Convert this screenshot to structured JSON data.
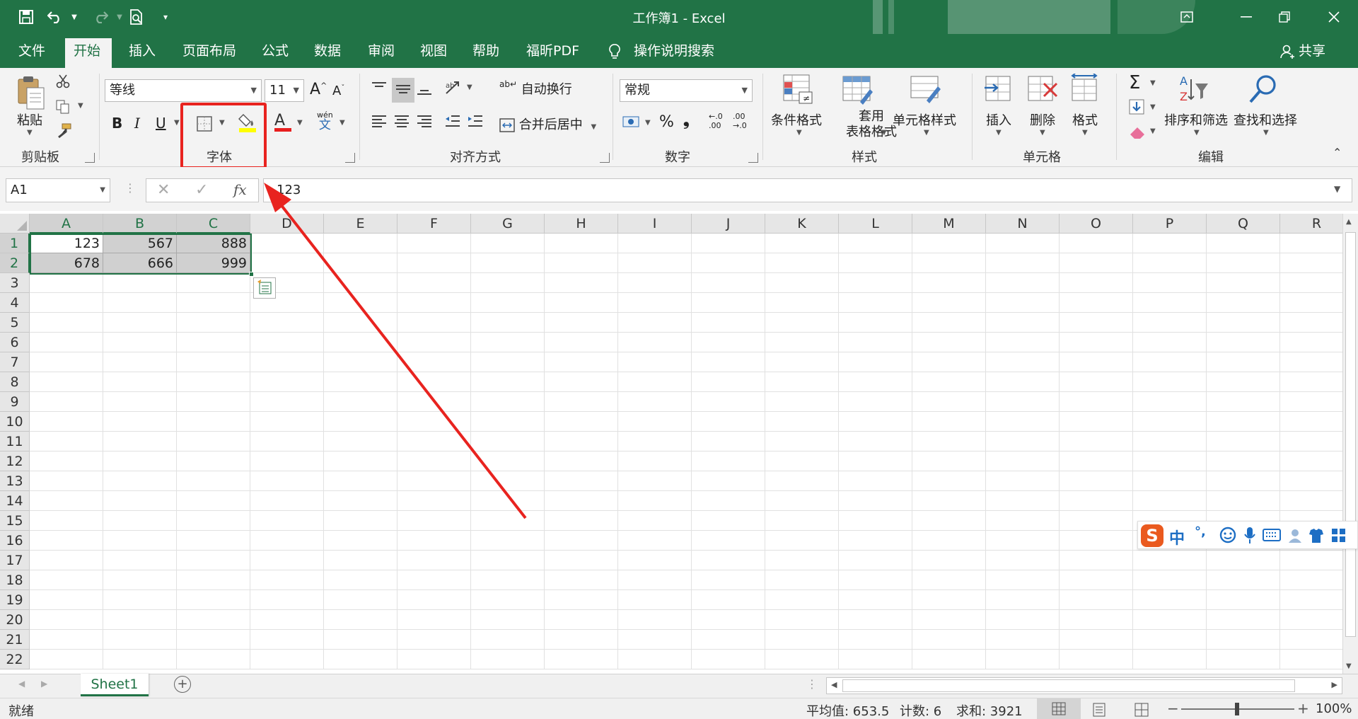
{
  "window": {
    "title": "工作簿1  -  Excel",
    "share_label": "共享"
  },
  "tabs": [
    {
      "label": "文件"
    },
    {
      "label": "开始"
    },
    {
      "label": "插入"
    },
    {
      "label": "页面布局"
    },
    {
      "label": "公式"
    },
    {
      "label": "数据"
    },
    {
      "label": "审阅"
    },
    {
      "label": "视图"
    },
    {
      "label": "帮助"
    },
    {
      "label": "福昕PDF"
    },
    {
      "label": "操作说明搜索"
    }
  ],
  "ribbon": {
    "clipboard": {
      "paste_label": "粘贴",
      "group_label": "剪贴板"
    },
    "font": {
      "font_name": "等线",
      "font_size": "11",
      "bold": "B",
      "italic": "I",
      "underline": "U",
      "font_color_glyph": "A",
      "phonetic_top": "wén",
      "phonetic_bottom": "文",
      "group_label": "字体"
    },
    "alignment": {
      "wrap_label": "自动换行",
      "merge_label": "合并后居中",
      "group_label": "对齐方式"
    },
    "number": {
      "format": "常规",
      "percent": "%",
      "comma": "❟",
      "inc_dec": ".00",
      "inc_dec_top": "←.0",
      "dec_dec_top": ".00",
      "dec_dec": "→.0",
      "group_label": "数字"
    },
    "styles": {
      "conditional_label": "条件格式",
      "table_label_1": "套用",
      "table_label_2": "表格格式",
      "cell_style_label": "单元格样式",
      "group_label": "样式"
    },
    "cells": {
      "insert_label": "插入",
      "delete_label": "删除",
      "format_label": "格式",
      "group_label": "单元格"
    },
    "editing": {
      "sort_label": "排序和筛选",
      "find_label": "查找和选择",
      "group_label": "编辑"
    }
  },
  "formula_bar": {
    "name_box": "A1",
    "fx": "fx",
    "content": "123"
  },
  "grid": {
    "columns": [
      "A",
      "B",
      "C",
      "D",
      "E",
      "F",
      "G",
      "H",
      "I",
      "J",
      "K",
      "L",
      "M",
      "N",
      "O",
      "P",
      "Q",
      "R"
    ],
    "rows": [
      "1",
      "2",
      "3",
      "4",
      "5",
      "6",
      "7",
      "8",
      "9",
      "10",
      "11",
      "12",
      "13",
      "14",
      "15",
      "16",
      "17",
      "18",
      "19",
      "20",
      "21",
      "22"
    ],
    "cells": [
      [
        "123",
        "567",
        "888"
      ],
      [
        "678",
        "666",
        "999"
      ]
    ]
  },
  "sheets": {
    "tabs": [
      "Sheet1"
    ],
    "add_glyph": "+"
  },
  "status": {
    "ready": "就绪",
    "average": "平均值: 653.5",
    "count": "计数: 6",
    "sum": "求和: 3921",
    "zoom": "100%"
  },
  "ime": {
    "mode": "中",
    "punct": "°,"
  },
  "colors": {
    "brand": "#217346",
    "highlight_frame": "#e8231f",
    "arrow": "#e8231f",
    "selection_fill": "#d0d0d0"
  }
}
